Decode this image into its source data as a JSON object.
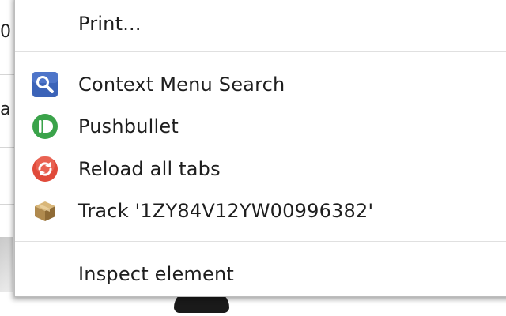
{
  "background_page": {
    "fragments": [
      "0",
      "a"
    ]
  },
  "context_menu": {
    "items": [
      {
        "label": "Print...",
        "icon": ""
      },
      {
        "label": "Context Menu Search",
        "icon": "magnifier-search-icon"
      },
      {
        "label": "Pushbullet",
        "icon": "pushbullet-icon"
      },
      {
        "label": "Reload all tabs",
        "icon": "reload-arrows-icon"
      },
      {
        "label": "Track '1ZY84V12YW00996382'",
        "icon": "package-box-icon"
      },
      {
        "label": "Inspect element",
        "icon": ""
      }
    ]
  },
  "colors": {
    "menu_background": "#ffffff",
    "menu_border": "#bdbdbd",
    "separator": "#e0e0e0",
    "text": "#1e1e1e",
    "search_icon_blue": "#3b63b8",
    "pushbullet_green": "#3aa34a",
    "reload_red": "#e04a3a",
    "package_tan": "#b08a4e"
  }
}
